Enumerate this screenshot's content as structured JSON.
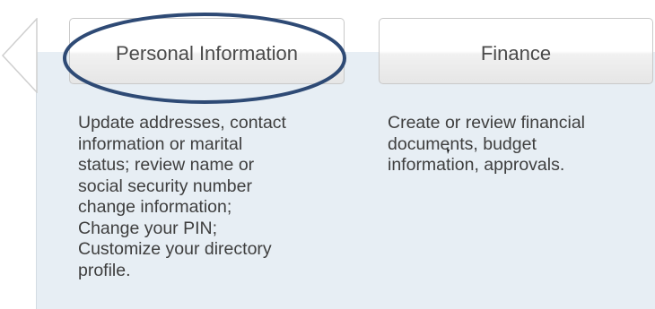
{
  "nav": {
    "back_icon": "left-triangle-arrow-icon"
  },
  "tabs": [
    {
      "label": "Personal Information",
      "description": "Update addresses, contact\ninformation or marital\nstatus; review name or\nsocial security number\nchange information;\nChange your PIN;\nCustomize your directory\nprofile."
    },
    {
      "label": "Finance",
      "description": "Create or review financial\ndocuments, budget\ninformation, approvals."
    }
  ],
  "annotation": {
    "type": "ellipse-highlight",
    "color": "#2e4a75",
    "target": "Personal Information"
  },
  "colors": {
    "panel_background": "#e7eef4",
    "button_border": "#c9c9c9",
    "text": "#3e3e3e"
  }
}
